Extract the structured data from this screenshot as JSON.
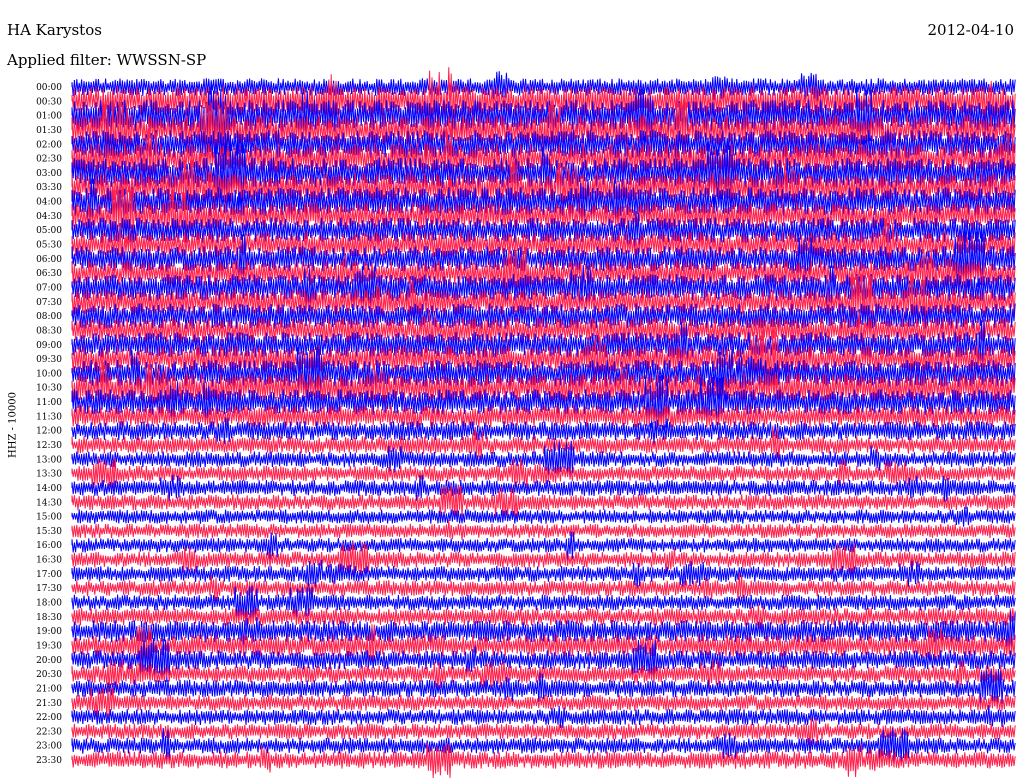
{
  "header": {
    "station": "HA Karystos",
    "date": "2012-04-10",
    "filter": "Applied filter: WWSSN-SP",
    "channel": "HHZ - 10000"
  },
  "colors": {
    "trace_a": "#0000ff",
    "trace_b": "#ff1f4a",
    "background": "#ffffff",
    "text": "#000000"
  },
  "chart_data": {
    "type": "line",
    "title": "HA Karystos",
    "subtitle": "Applied filter: WWSSN-SP",
    "xlabel": "",
    "ylabel": "HHZ - 10000",
    "grid": false,
    "legend": "none",
    "series_colors_alternate": [
      "#0000ff",
      "#ff1f4a"
    ],
    "tick_labels": [
      "00:00",
      "00:30",
      "01:00",
      "01:30",
      "02:00",
      "02:30",
      "03:00",
      "03:30",
      "04:00",
      "04:30",
      "05:00",
      "05:30",
      "06:00",
      "06:30",
      "07:00",
      "07:30",
      "08:00",
      "08:30",
      "09:00",
      "09:30",
      "10:00",
      "10:30",
      "11:00",
      "11:30",
      "12:00",
      "12:30",
      "13:00",
      "13:30",
      "14:00",
      "14:30",
      "15:00",
      "15:30",
      "16:00",
      "16:30",
      "17:00",
      "17:30",
      "18:00",
      "18:30",
      "19:00",
      "19:30",
      "20:00",
      "20:30",
      "21:00",
      "21:30",
      "22:00",
      "22:30",
      "23:00",
      "23:30"
    ],
    "relative_amplitude": [
      0.55,
      0.95,
      1.0,
      0.95,
      0.9,
      0.95,
      0.95,
      0.9,
      0.9,
      0.85,
      0.8,
      0.8,
      0.8,
      0.8,
      0.85,
      0.8,
      0.8,
      0.8,
      0.8,
      0.85,
      0.85,
      0.9,
      0.8,
      0.7,
      0.6,
      0.55,
      0.5,
      0.5,
      0.5,
      0.5,
      0.45,
      0.45,
      0.45,
      0.5,
      0.5,
      0.5,
      0.5,
      0.55,
      0.7,
      0.7,
      0.6,
      0.55,
      0.55,
      0.5,
      0.5,
      0.5,
      0.5,
      0.55
    ]
  }
}
